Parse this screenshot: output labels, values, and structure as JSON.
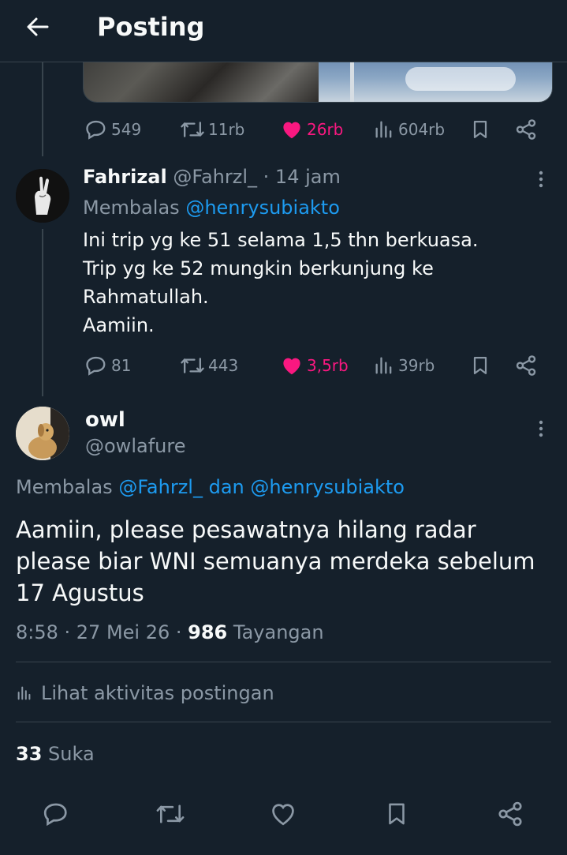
{
  "header": {
    "title": "Posting",
    "back_icon": "arrow-left-icon"
  },
  "quoted_post_stats": {
    "replies": "549",
    "reposts": "11rb",
    "likes": "26rb",
    "views": "604rb"
  },
  "reply": {
    "display_name": "Fahrizal",
    "handle": "@Fahrzl_",
    "time": "· 14 jam",
    "replying_prefix": "Membalas",
    "replying_to": "@henrysubiakto",
    "body": [
      "Ini trip yg ke 51 selama 1,5 thn berkuasa.",
      "Trip yg ke 52 mungkin berkunjung ke",
      "Rahmatullah.",
      "Aamiin."
    ],
    "stats": {
      "replies": "81",
      "reposts": "443",
      "likes": "3,5rb",
      "views": "39rb"
    }
  },
  "main_post": {
    "display_name": "owl",
    "handle": "@owlafure",
    "replying_prefix": "Membalas",
    "replying_to_1": "@Fahrzl_",
    "replying_join": "dan",
    "replying_to_2": "@henrysubiakto",
    "body": [
      "Aamiin, please pesawatnya hilang radar",
      "please biar WNI semuanya merdeka sebelum",
      "17 Agustus"
    ],
    "time": "8:58 · 27 Mei 26 · ",
    "views_count": "986",
    "views_label": "Tayangan",
    "activity_label": "Lihat aktivitas postingan",
    "likes_count": "33",
    "likes_label": "Suka"
  },
  "colors": {
    "background": "#15202b",
    "text": "#f7f9f9",
    "muted": "#8b98a5",
    "link": "#1d9bf0",
    "like": "#f91880",
    "border": "#38444d"
  }
}
